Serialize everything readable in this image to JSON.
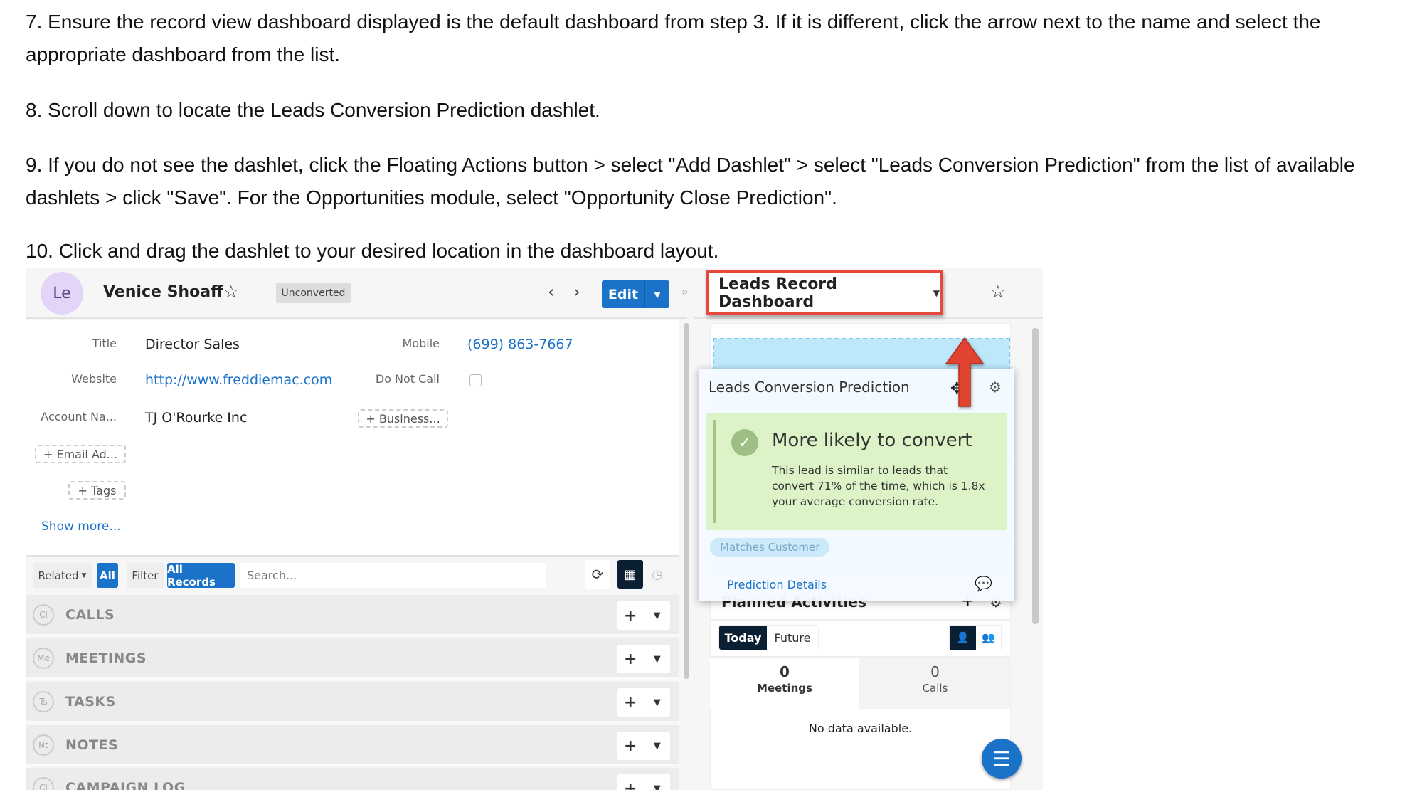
{
  "steps": [
    "7. Ensure the record view dashboard displayed is the default dashboard from step 3.  If it is different, click the arrow next to the name and select the appropriate dashboard from the list.",
    "8. Scroll down to locate the Leads Conversion Prediction dashlet.",
    "9. If you do not see the dashlet, click the Floating Actions button > select \"Add Dashlet\" > select \"Leads Conversion Prediction\" from the list of available dashlets > click \"Save\". For the Opportunities module, select \"Opportunity Close Prediction\".",
    "10. Click and drag the dashlet to your desired location in the dashboard layout."
  ],
  "record": {
    "avatar": "Le",
    "name": "Venice Shoaff",
    "status": "Unconverted",
    "edit_label": "Edit",
    "collapse": "»",
    "fields": {
      "title_label": "Title",
      "title": "Director Sales",
      "website_label": "Website",
      "website": "http://www.freddiemac.com",
      "account_label": "Account Na...",
      "account": "TJ O'Rourke Inc",
      "mobile_label": "Mobile",
      "mobile": "(699) 863-7667",
      "dnc_label": "Do Not Call",
      "business_btn": "+ Business...",
      "email_btn": "+ Email Ad...",
      "tags_btn": "+ Tags"
    },
    "show_more": "Show more..."
  },
  "toolbar": {
    "related": "Related",
    "all": "All",
    "filter": "Filter",
    "all_records": "All Records",
    "search_placeholder": "Search..."
  },
  "subpanels": [
    {
      "abbr": "Cl",
      "label": "CALLS"
    },
    {
      "abbr": "Me",
      "label": "MEETINGS"
    },
    {
      "abbr": "Ts",
      "label": "TASKS"
    },
    {
      "abbr": "Nt",
      "label": "NOTES"
    },
    {
      "abbr": "Cl",
      "label": "CAMPAIGN LOG"
    }
  ],
  "dashboard": {
    "title": "Leads Record Dashboard",
    "dashlet": {
      "title": "Leads Conversion Prediction",
      "headline": "More likely to convert",
      "body": "This lead is similar to leads that convert 71% of the time, which is 1.8x your average conversion rate.",
      "tag": "Matches Customer",
      "details_link": "Prediction Details"
    },
    "planned": {
      "title": "Planned Activities",
      "today": "Today",
      "future": "Future",
      "meetings_count": "0",
      "meetings_label": "Meetings",
      "calls_count": "0",
      "calls_label": "Calls",
      "empty": "No data available."
    }
  },
  "colors": {
    "accent": "#1a73c9",
    "highlight": "#e8483b",
    "success_bg": "#dcf3c8",
    "drop_zone": "#bde8fb",
    "dark": "#0b1f33"
  }
}
